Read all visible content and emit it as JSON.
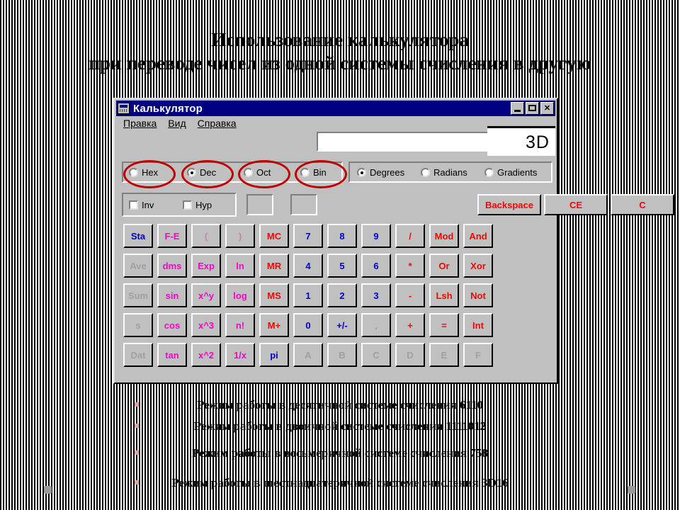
{
  "slide": {
    "heading_line1": "Использование калькулятора",
    "heading_line2": "при переводе чисел из одной системы счисления в другую",
    "accent_color": "#c00000",
    "background": "striped-vertical-black-white"
  },
  "calculator": {
    "window_title": "Калькулятор",
    "icon": "calculator-icon",
    "titlebar_buttons": {
      "minimize": "_",
      "maximize": "□",
      "close": "✕"
    },
    "menu": [
      "Правка",
      "Вид",
      "Справка"
    ],
    "display_value": "",
    "overlay_patch_value": "3D",
    "base_group": {
      "options": [
        "Hex",
        "Dec",
        "Oct",
        "Bin"
      ],
      "selected": "Dec",
      "annotated": [
        "Hex",
        "Dec",
        "Oct",
        "Bin"
      ]
    },
    "angle_group": {
      "options": [
        "Degrees",
        "Radians",
        "Gradients"
      ],
      "selected": "Degrees"
    },
    "modifiers": [
      {
        "label": "Inv",
        "checked": false
      },
      {
        "label": "Hyp",
        "checked": false
      }
    ],
    "edit_buttons": [
      {
        "label": "Backspace",
        "color": "red"
      },
      {
        "label": "CE",
        "color": "red"
      },
      {
        "label": "C",
        "color": "red"
      }
    ],
    "keypad": [
      [
        {
          "label": "Sta",
          "color": "blue"
        },
        {
          "label": "F-E",
          "color": "magenta"
        },
        {
          "label": "(",
          "color": "dim-m"
        },
        {
          "label": ")",
          "color": "dim-m"
        },
        {
          "label": "MC",
          "color": "red"
        },
        {
          "label": "7",
          "color": "blue"
        },
        {
          "label": "8",
          "color": "blue"
        },
        {
          "label": "9",
          "color": "blue"
        },
        {
          "label": "/",
          "color": "red"
        },
        {
          "label": "Mod",
          "color": "red"
        },
        {
          "label": "And",
          "color": "red"
        }
      ],
      [
        {
          "label": "Ave",
          "color": "gray"
        },
        {
          "label": "dms",
          "color": "magenta"
        },
        {
          "label": "Exp",
          "color": "magenta"
        },
        {
          "label": "ln",
          "color": "magenta"
        },
        {
          "label": "MR",
          "color": "red"
        },
        {
          "label": "4",
          "color": "blue"
        },
        {
          "label": "5",
          "color": "blue"
        },
        {
          "label": "6",
          "color": "blue"
        },
        {
          "label": "*",
          "color": "red"
        },
        {
          "label": "Or",
          "color": "red"
        },
        {
          "label": "Xor",
          "color": "red"
        }
      ],
      [
        {
          "label": "Sum",
          "color": "gray"
        },
        {
          "label": "sin",
          "color": "magenta"
        },
        {
          "label": "x^y",
          "color": "magenta"
        },
        {
          "label": "log",
          "color": "magenta"
        },
        {
          "label": "MS",
          "color": "red"
        },
        {
          "label": "1",
          "color": "blue"
        },
        {
          "label": "2",
          "color": "blue"
        },
        {
          "label": "3",
          "color": "blue"
        },
        {
          "label": "-",
          "color": "red"
        },
        {
          "label": "Lsh",
          "color": "red"
        },
        {
          "label": "Not",
          "color": "red"
        }
      ],
      [
        {
          "label": "s",
          "color": "gray"
        },
        {
          "label": "cos",
          "color": "magenta"
        },
        {
          "label": "x^3",
          "color": "magenta"
        },
        {
          "label": "n!",
          "color": "magenta"
        },
        {
          "label": "M+",
          "color": "red"
        },
        {
          "label": "0",
          "color": "blue"
        },
        {
          "label": "+/-",
          "color": "blue"
        },
        {
          "label": ",",
          "color": "gray"
        },
        {
          "label": "+",
          "color": "red"
        },
        {
          "label": "=",
          "color": "red"
        },
        {
          "label": "Int",
          "color": "red"
        }
      ],
      [
        {
          "label": "Dat",
          "color": "gray"
        },
        {
          "label": "tan",
          "color": "magenta"
        },
        {
          "label": "x^2",
          "color": "magenta"
        },
        {
          "label": "1/x",
          "color": "magenta"
        },
        {
          "label": "pi",
          "color": "blue"
        },
        {
          "label": "A",
          "color": "gray"
        },
        {
          "label": "B",
          "color": "gray"
        },
        {
          "label": "C",
          "color": "gray"
        },
        {
          "label": "D",
          "color": "gray"
        },
        {
          "label": "E",
          "color": "gray"
        },
        {
          "label": "F",
          "color": "gray"
        }
      ]
    ]
  },
  "notes": [
    {
      "text": "Режим работы в десятичной системе счисления",
      "value": "61",
      "base": "10"
    },
    {
      "text": "Режим работы в двоичной системе счисления",
      "value": "111101",
      "base": "2"
    },
    {
      "text": "Режим работы в восьмеричной системе счисления",
      "value": "75",
      "base": "8"
    },
    {
      "text": "Режим работы в шестнадцатеричной системе счисления",
      "value": "3D",
      "base": "16"
    }
  ]
}
